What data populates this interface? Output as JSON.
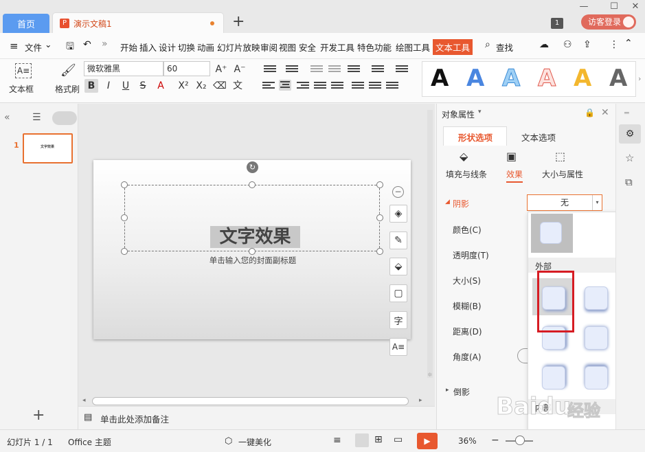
{
  "tabs": {
    "home": "首页",
    "document": "演示文稿1",
    "new_tab": "+"
  },
  "titlebar": {
    "window_count": "1",
    "visitor_login": "访客登录"
  },
  "menu": {
    "file": "文件",
    "items": [
      "开始",
      "插入",
      "设计",
      "切换",
      "动画",
      "幻灯片放映",
      "审阅",
      "视图",
      "安全",
      "开发工具",
      "特色功能",
      "绘图工具"
    ],
    "active": "文本工具",
    "search": "查找"
  },
  "ribbon": {
    "textbox_label": "文本框",
    "format_painter": "格式刷",
    "font_name": "微软雅黑",
    "font_size": "60",
    "gallery_letter": "A"
  },
  "colors": {
    "accent": "#e8582f",
    "tab_blue": "#5b9bf0",
    "selection_red": "#d61c23"
  },
  "left_panel": {
    "slide_number": "1",
    "thumb_title": "文字效果"
  },
  "slide": {
    "title": "文字效果",
    "subtitle": "单击输入您的封面副标题"
  },
  "notes": {
    "placeholder": "单击此处添加备注"
  },
  "properties": {
    "panel_title": "对象属性",
    "tab_shape": "形状选项",
    "tab_text": "文本选项",
    "sub_fill": "填充与线条",
    "sub_effect": "效果",
    "sub_size": "大小与属性",
    "shadow_section": "阴影",
    "shadow_value": "无",
    "fields": [
      "颜色(C)",
      "透明度(T)",
      "大小(S)",
      "模糊(B)",
      "距离(D)",
      "角度(A)"
    ],
    "reflection": "倒影"
  },
  "shadow_popup": {
    "outer_label": "外部",
    "inner_label": "内部"
  },
  "watermark": {
    "text": "Baidu",
    "sub": "经验"
  },
  "status": {
    "slide_info": "幻灯片 1 / 1",
    "theme": "Office 主题",
    "beautify": "一键美化",
    "zoom": "36%"
  }
}
